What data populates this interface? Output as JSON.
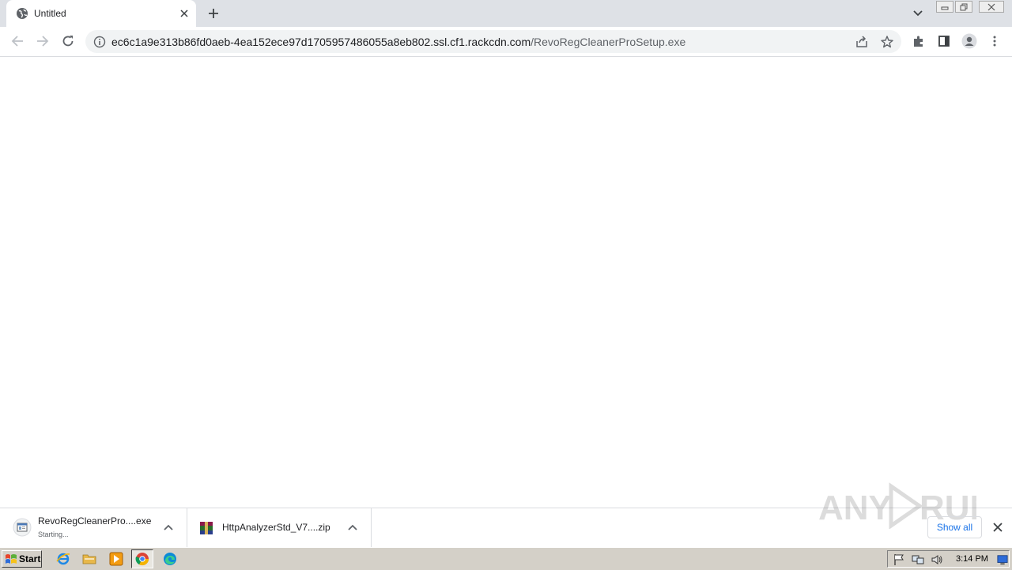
{
  "tab": {
    "title": "Untitled"
  },
  "address": {
    "host": "ec6c1a9e313b86fd0aeb-4ea152ece97d1705957486055a8eb802.ssl.cf1.rackcdn.com",
    "path": "/RevoRegCleanerProSetup.exe"
  },
  "downloads": [
    {
      "name": "RevoRegCleanerPro....exe",
      "status": "Starting...",
      "icon": "installer-icon"
    },
    {
      "name": "HttpAnalyzerStd_V7....zip",
      "status": "",
      "icon": "winrar-archive-icon"
    }
  ],
  "shelf": {
    "show_all_label": "Show all",
    "watermark": "ANY RUN"
  },
  "taskbar": {
    "start_label": "Start",
    "clock": "3:14 PM",
    "quick_launch": [
      "internet-explorer-icon",
      "folder-icon",
      "media-player-icon",
      "chrome-icon",
      "edge-icon"
    ]
  },
  "colors": {
    "tabstrip": "#dee1e6",
    "accent": "#1a73e8",
    "taskbar": "#d4d0c8"
  }
}
